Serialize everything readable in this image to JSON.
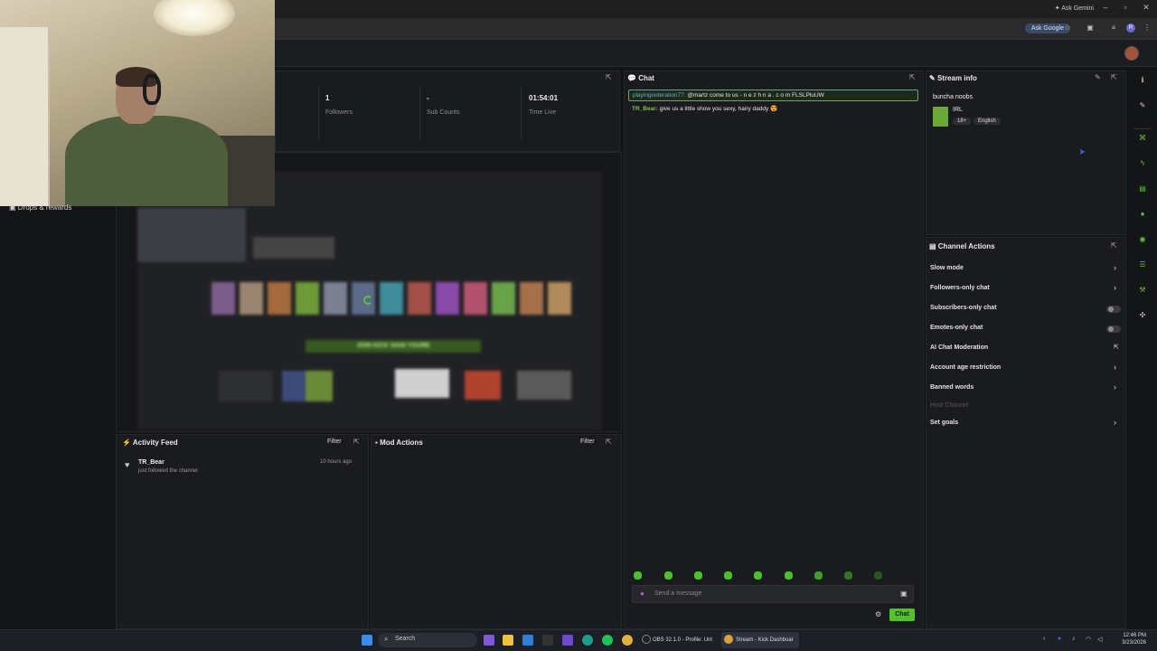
{
  "browser": {
    "ask_gemini": "Ask Gemini",
    "ask_google": "Ask Google",
    "profile_initial": "R"
  },
  "left_nav": {
    "drops_label": "Drops & rewards"
  },
  "stats": [
    {
      "value": "1",
      "label": "Followers"
    },
    {
      "value": "-",
      "label": "Sub Counts"
    },
    {
      "value": "01:54:01",
      "label": "Time Live"
    }
  ],
  "chat": {
    "title": "Chat",
    "pinned": {
      "user": "playingreiteration77:",
      "text": "@martz come to us - n e z h n a . c o m FLSLPluUW"
    },
    "messages": [
      {
        "user": "TR_Bear:",
        "text": "give us a little show you sexy, hairy daddy 😍"
      }
    ],
    "input_placeholder": "Send a message",
    "send_label": "Chat"
  },
  "stream_info": {
    "title": "Stream info",
    "stream_title": "buncha noobs",
    "category": "IRL",
    "tags": [
      "18+",
      "English"
    ]
  },
  "channel_actions": {
    "title": "Channel Actions",
    "items": [
      {
        "label": "Slow mode",
        "kind": "arrow"
      },
      {
        "label": "Followers-only chat",
        "kind": "arrow"
      },
      {
        "label": "Subscribers-only chat",
        "kind": "toggle",
        "enabled": false
      },
      {
        "label": "Emotes-only chat",
        "kind": "toggle",
        "enabled": false
      },
      {
        "label": "AI Chat Moderation",
        "kind": "external"
      },
      {
        "label": "Account age restriction",
        "kind": "arrow"
      },
      {
        "label": "Banned words",
        "kind": "arrow"
      },
      {
        "label": "Host Channel",
        "kind": "disabled"
      },
      {
        "label": "Set goals",
        "kind": "arrow"
      }
    ]
  },
  "activity_feed": {
    "title": "Activity Feed",
    "filter": "Filter",
    "items": [
      {
        "user": "TR_Bear",
        "action": "just followed the channel",
        "time": "10 hours ago"
      }
    ]
  },
  "mod_actions": {
    "title": "Mod Actions",
    "filter": "Filter"
  },
  "video_preview": {
    "banner": "JOIN KICK SIGN YOURE"
  },
  "taskbar": {
    "search_label": "Search",
    "tasks": [
      {
        "label": "OBS 32.1.0 - Profile: Unt"
      },
      {
        "label": "Stream - Kick Dashboar"
      }
    ],
    "time": "12:46 PM",
    "date": "3/23/2026"
  },
  "colors": {
    "accent": "#53c12e",
    "panel_bg": "#1a1b1e",
    "page_bg": "#141517"
  }
}
